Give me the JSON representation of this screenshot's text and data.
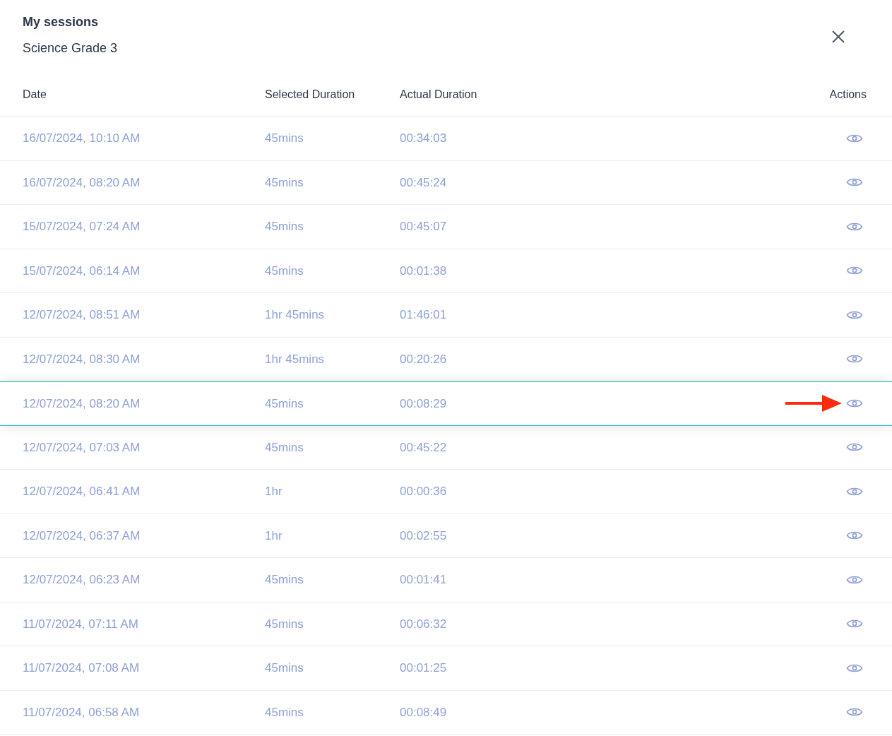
{
  "header": {
    "title": "My sessions",
    "subtitle": "Science Grade 3"
  },
  "table": {
    "columns": [
      "Date",
      "Selected Duration",
      "Actual Duration",
      "Actions"
    ],
    "rows": [
      {
        "date": "16/07/2024, 10:10 AM",
        "selected_duration": "45mins",
        "actual_duration": "00:34:03",
        "selected": false
      },
      {
        "date": "16/07/2024, 08:20 AM",
        "selected_duration": "45mins",
        "actual_duration": "00:45:24",
        "selected": false
      },
      {
        "date": "15/07/2024, 07:24 AM",
        "selected_duration": "45mins",
        "actual_duration": "00:45:07",
        "selected": false
      },
      {
        "date": "15/07/2024, 06:14 AM",
        "selected_duration": "45mins",
        "actual_duration": "00:01:38",
        "selected": false
      },
      {
        "date": "12/07/2024, 08:51 AM",
        "selected_duration": "1hr 45mins",
        "actual_duration": "01:46:01",
        "selected": false
      },
      {
        "date": "12/07/2024, 08:30 AM",
        "selected_duration": "1hr 45mins",
        "actual_duration": "00:20:26",
        "selected": false
      },
      {
        "date": "12/07/2024, 08:20 AM",
        "selected_duration": "45mins",
        "actual_duration": "00:08:29",
        "selected": true
      },
      {
        "date": "12/07/2024, 07:03 AM",
        "selected_duration": "45mins",
        "actual_duration": "00:45:22",
        "selected": false
      },
      {
        "date": "12/07/2024, 06:41 AM",
        "selected_duration": "1hr",
        "actual_duration": "00:00:36",
        "selected": false
      },
      {
        "date": "12/07/2024, 06:37 AM",
        "selected_duration": "1hr",
        "actual_duration": "00:02:55",
        "selected": false
      },
      {
        "date": "12/07/2024, 06:23 AM",
        "selected_duration": "45mins",
        "actual_duration": "00:01:41",
        "selected": false
      },
      {
        "date": "11/07/2024, 07:11 AM",
        "selected_duration": "45mins",
        "actual_duration": "00:06:32",
        "selected": false
      },
      {
        "date": "11/07/2024, 07:08 AM",
        "selected_duration": "45mins",
        "actual_duration": "00:01:25",
        "selected": false
      },
      {
        "date": "11/07/2024, 06:58 AM",
        "selected_duration": "45mins",
        "actual_duration": "00:08:49",
        "selected": false
      }
    ]
  }
}
